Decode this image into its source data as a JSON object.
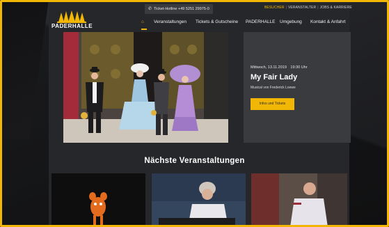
{
  "header": {
    "hotline": "Ticket-Hotline +49 5251 29975-0",
    "top_links": [
      "BESUCHER",
      "VERANSTALTER",
      "JOBS & KARRIERE"
    ],
    "logo_text": "PADERHALLE",
    "nav": [
      "Veranstaltungen",
      "Tickets & Gutscheine",
      "PADERHALLE",
      "Umgebung",
      "Kontakt & Anfahrt"
    ],
    "icons": {
      "home": "home-icon",
      "phone": "phone-icon"
    }
  },
  "hero": {
    "date": "Mittwoch, 13.11.2019",
    "time": "19:30 Uhr",
    "title": "My Fair Lady",
    "subtitle": "Musical von Frederick Loewe",
    "button": "Infos und Tickets"
  },
  "section": {
    "title": "Nächste Veranstaltungen"
  },
  "colors": {
    "accent": "#f2b705",
    "background": "#26272a",
    "panel": "#3a3b3f"
  }
}
